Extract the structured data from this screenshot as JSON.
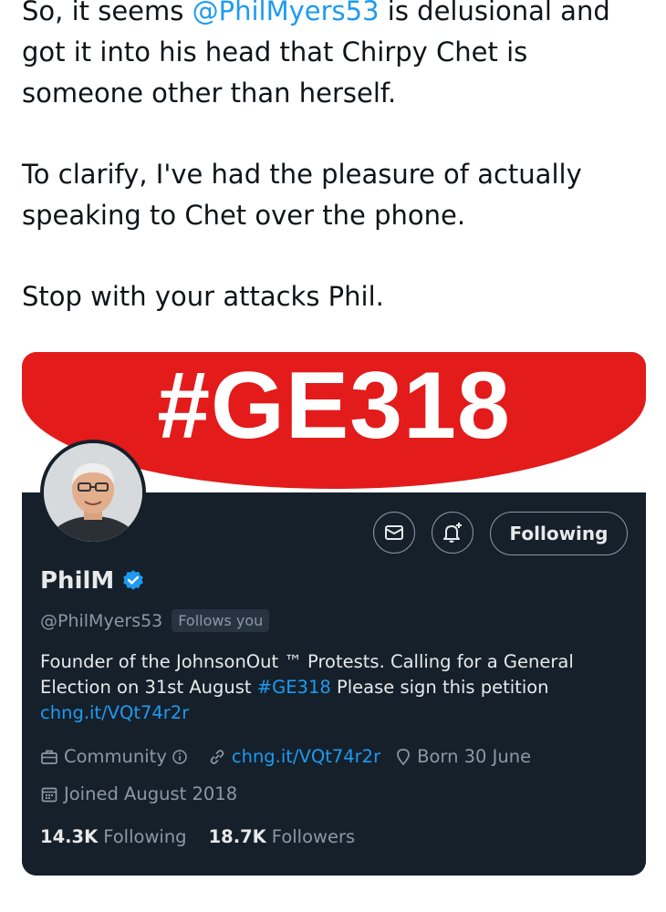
{
  "tweet": {
    "line1_prefix": "So, it seems ",
    "mention": "@PhilMyers53",
    "line1_suffix": " is delusional and got it into his head that Chirpy Chet is someone other than herself.",
    "paragraph2": "To clarify, I've had the pleasure of actually speaking to Chet over the phone.",
    "paragraph3": "Stop with your attacks Phil."
  },
  "profile": {
    "banner_text": "#GE318",
    "follow_button": "Following",
    "name": "PhilM",
    "handle": "@PhilMyers53",
    "follows_you": "Follows you",
    "bio_part1": "Founder of the JohnsonOut ™ Protests. Calling for a General Election on 31st August ",
    "bio_hashtag": "#GE318",
    "bio_part2": "  Please sign this petition ",
    "bio_link": "chng.it/VQt74r2r",
    "category": "Community",
    "website": "chng.it/VQt74r2r",
    "born": "Born 30 June",
    "joined": "Joined August 2018",
    "following_count": "14.3K",
    "following_label": "Following",
    "followers_count": "18.7K",
    "followers_label": "Followers"
  },
  "icons": {
    "message": "message-icon",
    "notify": "bell-plus-icon",
    "verified": "verified-badge-icon",
    "category": "briefcase-icon",
    "info": "info-icon",
    "link": "link-icon",
    "location": "location-pin-icon",
    "calendar": "calendar-icon"
  },
  "colors": {
    "accent": "#1d9bf0",
    "banner_red": "#e31b1b",
    "card_bg": "#15202b",
    "muted": "#8b98a5"
  }
}
